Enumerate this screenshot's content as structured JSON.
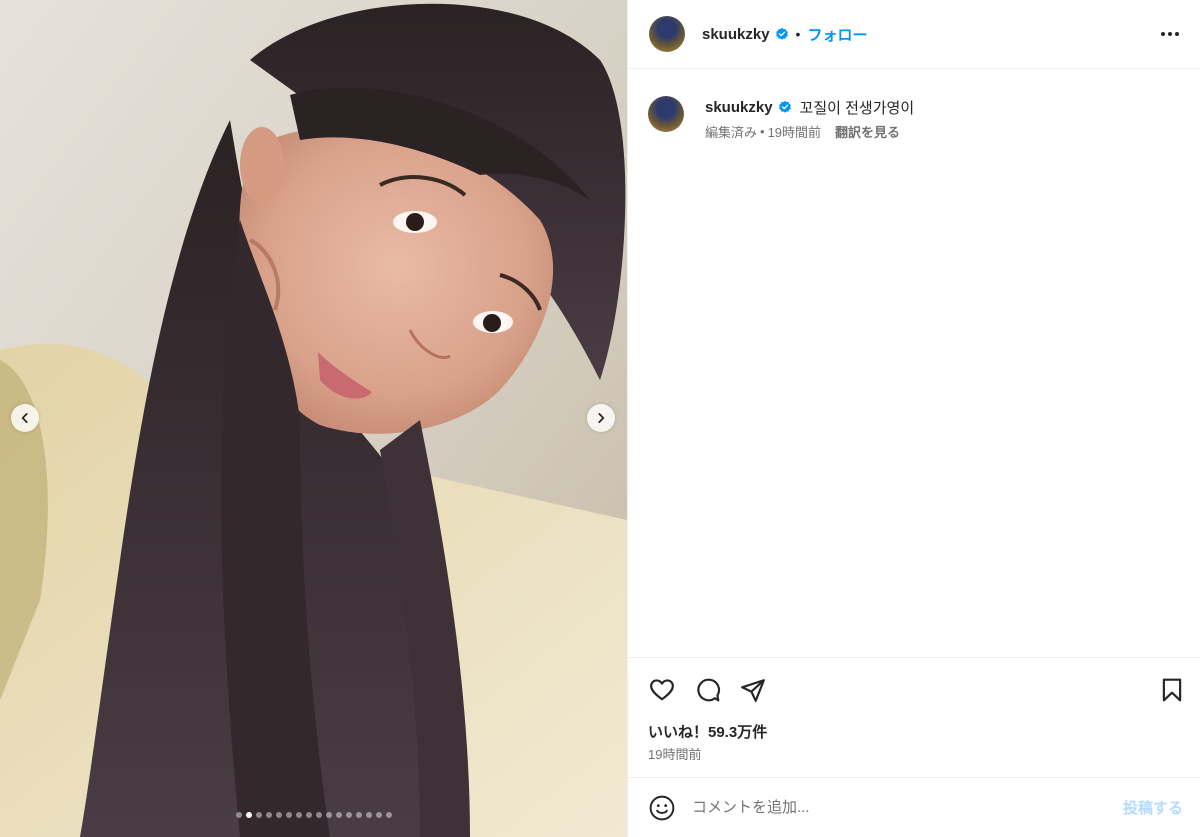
{
  "post": {
    "username": "skuukzky",
    "verified": true,
    "follow_label": "フォロー",
    "separator": "•",
    "more_icon": "more-horizontal-icon"
  },
  "caption": {
    "username": "skuukzky",
    "text": "꼬질이 전생가영이",
    "edited": "編集済み",
    "meta_separator": "•",
    "time": "19時間前",
    "translate_label": "翻訳を見る"
  },
  "carousel": {
    "slide_count": 16,
    "active_index": 1,
    "prev_icon": "chevron-left-icon",
    "next_icon": "chevron-right-icon"
  },
  "actions": {
    "like_icon": "heart-icon",
    "comment_icon": "comment-icon",
    "share_icon": "send-icon",
    "save_icon": "bookmark-icon",
    "likes_text": "いいね！59.3万件",
    "timestamp": "19時間前"
  },
  "comment_box": {
    "placeholder": "コメントを追加...",
    "post_label": "投稿する",
    "emoji_icon": "emoji-icon"
  },
  "colors": {
    "accent": "#0095f6",
    "verified": "#0095f6",
    "post_disabled": "#b3dbff",
    "secondary_text": "#737373"
  }
}
